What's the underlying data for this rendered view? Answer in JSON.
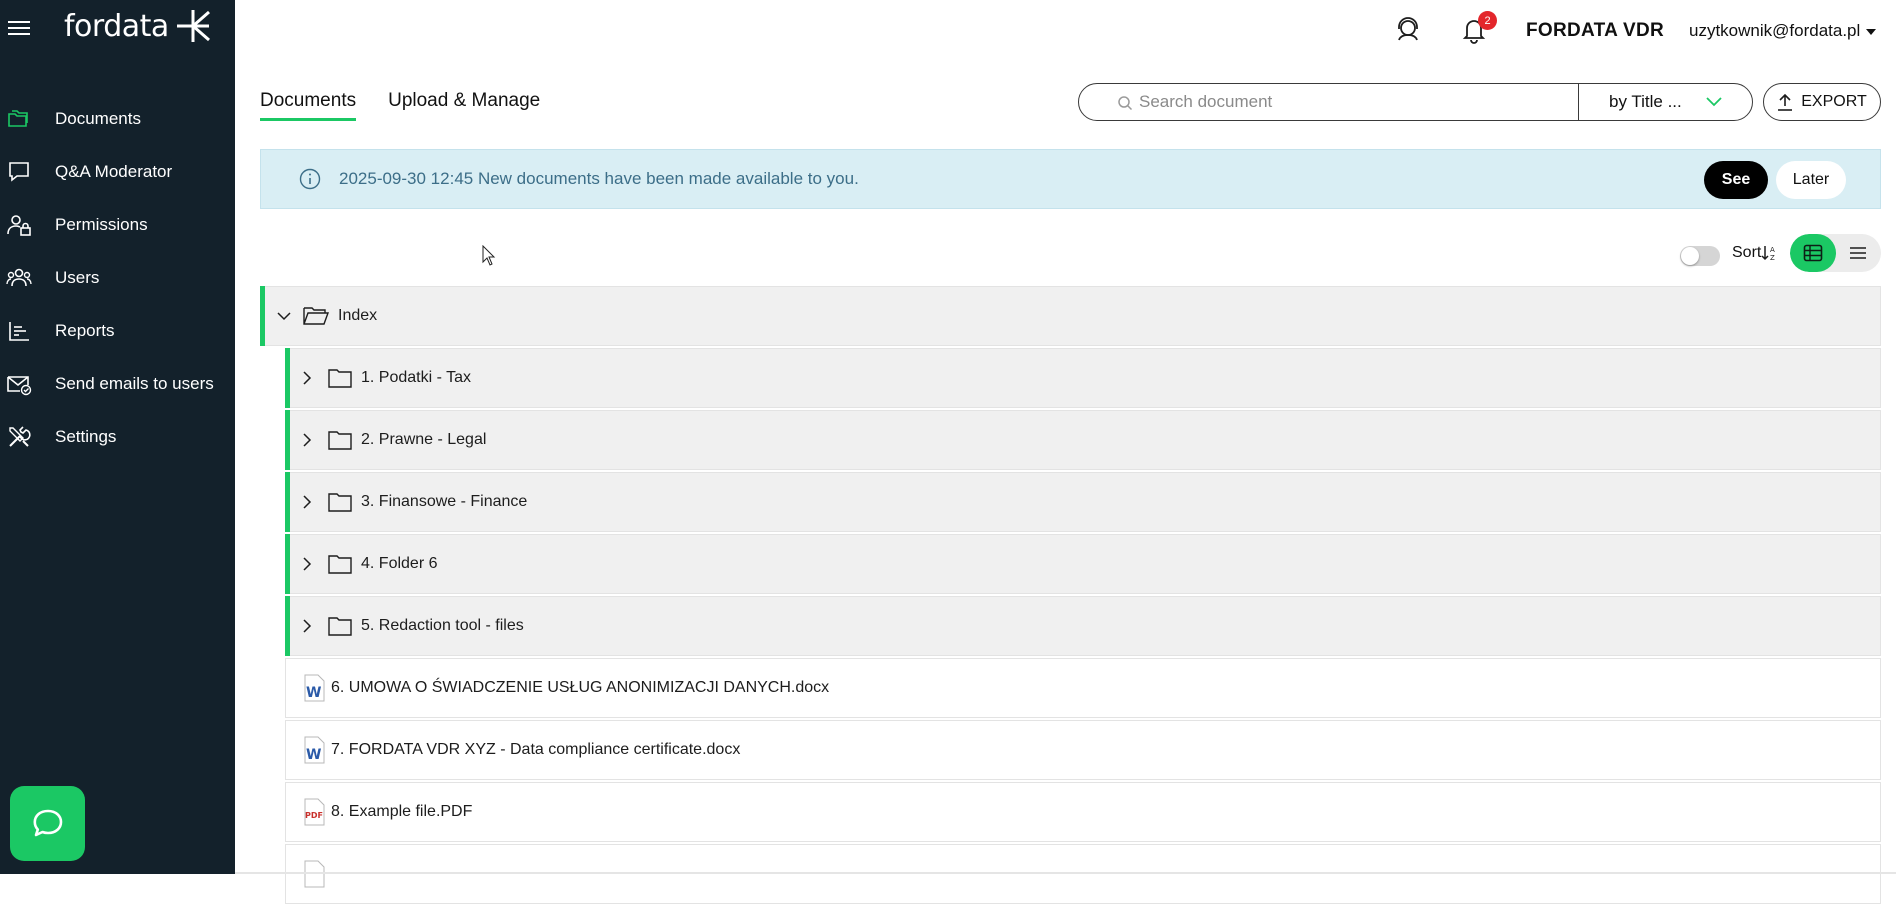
{
  "sidebar": {
    "logo_text": "fordata",
    "items": [
      {
        "label": "Documents",
        "icon": "folders-icon"
      },
      {
        "label": "Q&A Moderator",
        "icon": "chat-icon"
      },
      {
        "label": "Permissions",
        "icon": "user-lock-icon"
      },
      {
        "label": "Users",
        "icon": "users-icon"
      },
      {
        "label": "Reports",
        "icon": "chart-icon"
      },
      {
        "label": "Send emails to users",
        "icon": "mail-check-icon"
      },
      {
        "label": "Settings",
        "icon": "tools-icon"
      }
    ]
  },
  "header": {
    "notifications_count": "2",
    "brand": "FORDATA VDR",
    "user_email": "uzytkownik@fordata.pl"
  },
  "tabs": [
    {
      "label": "Documents",
      "active": true
    },
    {
      "label": "Upload & Manage",
      "active": false
    }
  ],
  "search": {
    "placeholder": "Search document",
    "by_label": "by Title ..."
  },
  "export_label": "EXPORT",
  "notice": {
    "text": "2025-09-30 12:45 New documents have been made available to you.",
    "see_label": "See",
    "later_label": "Later"
  },
  "toolbar": {
    "sort_label": "Sort"
  },
  "tree": {
    "root": "Index",
    "folders": [
      "1. Podatki - Tax",
      "2. Prawne - Legal",
      "3. Finansowe - Finance",
      "4. Folder 6",
      "5. Redaction tool - files"
    ],
    "files": [
      {
        "name": "6. UMOWA O ŚWIADCZENIE USŁUG ANONIMIZACJI DANYCH.docx",
        "type": "word"
      },
      {
        "name": "7. FORDATA VDR XYZ - Data compliance certificate.docx",
        "type": "word"
      },
      {
        "name": "8. Example file.PDF",
        "type": "pdf"
      }
    ]
  },
  "colors": {
    "sidebar_bg": "#13212b",
    "accent": "#1bc864",
    "notice_bg": "#d9eef4",
    "badge": "#e3262b"
  }
}
